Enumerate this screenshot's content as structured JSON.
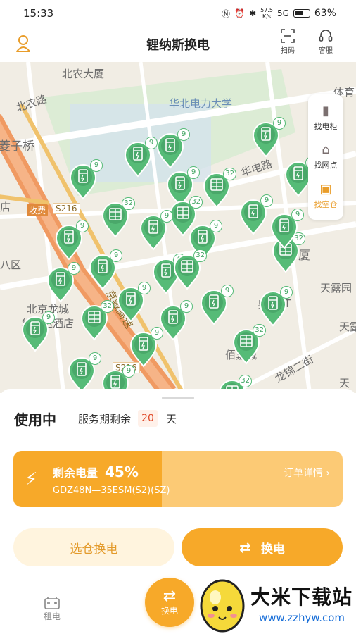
{
  "status_bar": {
    "time": "15:33",
    "network_speed_value": "57.5",
    "network_speed_unit": "K/s",
    "signal": "5G",
    "battery": "63%"
  },
  "header": {
    "title": "锂纳斯换电",
    "scan_label": "扫码",
    "service_label": "客服"
  },
  "map": {
    "labels": {
      "beinong": "北农大厦",
      "beinong_road": "北农路",
      "ncepu": "华北电力大学",
      "huadian_road": "华电路",
      "qiaozi": "菱子桥",
      "toll": "收费",
      "s216_a": "S216",
      "s216_b": "S216",
      "ba_qu": "八区",
      "dian": "店",
      "hotel_1": "北京龙城",
      "hotel_2": "华美达酒店",
      "highway": "京藏高速",
      "sha": "厦",
      "guo": "果核",
      "t": "T",
      "tianlu_1": "天露园",
      "tianlu_2": "天露",
      "tian": "天",
      "baixin": "佰嘉城",
      "longjin": "龙锦二街",
      "ti": "体育"
    },
    "side_panel": {
      "find_cabinet": "找电柜",
      "find_outlet": "找网点",
      "find_empty": "找空仓"
    },
    "pins": [
      {
        "kind": "single",
        "count": "9"
      },
      {
        "kind": "single",
        "count": "9"
      },
      {
        "kind": "single",
        "count": "9"
      },
      {
        "kind": "single",
        "count": "9"
      },
      {
        "kind": "single",
        "count": "9"
      },
      {
        "kind": "multi",
        "count": "32"
      },
      {
        "kind": "single",
        "count": "9"
      },
      {
        "kind": "multi",
        "count": "32"
      },
      {
        "kind": "multi",
        "count": "32"
      },
      {
        "kind": "single",
        "count": "9"
      },
      {
        "kind": "single",
        "count": "9"
      },
      {
        "kind": "single",
        "count": "9"
      },
      {
        "kind": "single",
        "count": "9"
      },
      {
        "kind": "multi",
        "count": "32"
      },
      {
        "kind": "single",
        "count": "9"
      },
      {
        "kind": "single",
        "count": "9"
      },
      {
        "kind": "single",
        "count": "9"
      },
      {
        "kind": "multi",
        "count": "32"
      },
      {
        "kind": "single",
        "count": "9"
      },
      {
        "kind": "single",
        "count": "9"
      },
      {
        "kind": "multi",
        "count": "32"
      },
      {
        "kind": "single",
        "count": "9"
      },
      {
        "kind": "single",
        "count": "9"
      },
      {
        "kind": "single",
        "count": "9"
      },
      {
        "kind": "single",
        "count": "9"
      },
      {
        "kind": "single",
        "count": "9"
      },
      {
        "kind": "multi",
        "count": "32"
      },
      {
        "kind": "single",
        "count": "9"
      },
      {
        "kind": "multi",
        "count": "32"
      },
      {
        "kind": "single",
        "count": "9"
      }
    ],
    "accent_green": "#56bb77"
  },
  "sheet": {
    "status": "使用中",
    "service_label": "服务期剩余",
    "service_days": "20",
    "service_unit": "天",
    "battery": {
      "label": "剩余电量",
      "percent_text": "45%",
      "level_fraction": 0.45,
      "model": "GDZ48N—35ESM(S2)(SZ)",
      "order_link": "订单详情 ›"
    },
    "btn_select": "选仓换电",
    "btn_swap": "换电",
    "accent": "#f7a929"
  },
  "tabbar": {
    "rent": "租电",
    "swap": "换电"
  },
  "watermark": {
    "title": "大米下载站",
    "url": "www.zzhyw.com"
  }
}
